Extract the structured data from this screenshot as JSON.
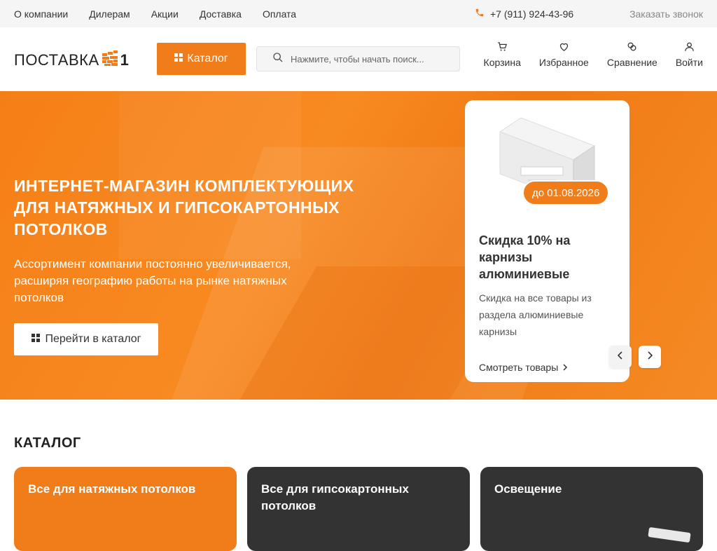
{
  "topbar": {
    "nav": [
      "О компании",
      "Дилерам",
      "Акции",
      "Доставка",
      "Оплата"
    ],
    "phone": "+7 (911) 924-43-96",
    "callback": "Заказать звонок"
  },
  "header": {
    "logo_text": "ПОСТАВКА",
    "logo_num": "1",
    "catalog_label": "Каталог",
    "search_placeholder": "Нажмите, чтобы начать поиск...",
    "icons": {
      "cart": "Корзина",
      "favorites": "Избранное",
      "compare": "Сравнение",
      "login": "Войти"
    }
  },
  "hero": {
    "title": "ИНТЕРНЕТ-МАГАЗИН КОМПЛЕКТУЮЩИХ ДЛЯ НАТЯЖНЫХ И ГИПСОКАРТОННЫХ ПОТОЛКОВ",
    "subtitle": "Ассортимент компании постоянно увеличивается, расширяя географию работы на рынке натяжных потолков",
    "button": "Перейти в каталог"
  },
  "promo": {
    "badge": "до 01.08.2026",
    "title": "Скидка 10% на карнизы алюминиевые",
    "description": "Скидка на все товары из раздела алюминиевые карнизы",
    "link": "Смотреть товары"
  },
  "catalog": {
    "heading": "КАТАЛОГ",
    "cards": [
      "Все для натяжных потолков",
      "Все для гипсокартонных потолков",
      "Освещение"
    ]
  },
  "colors": {
    "accent": "#f07c1a",
    "dark": "#333333"
  }
}
